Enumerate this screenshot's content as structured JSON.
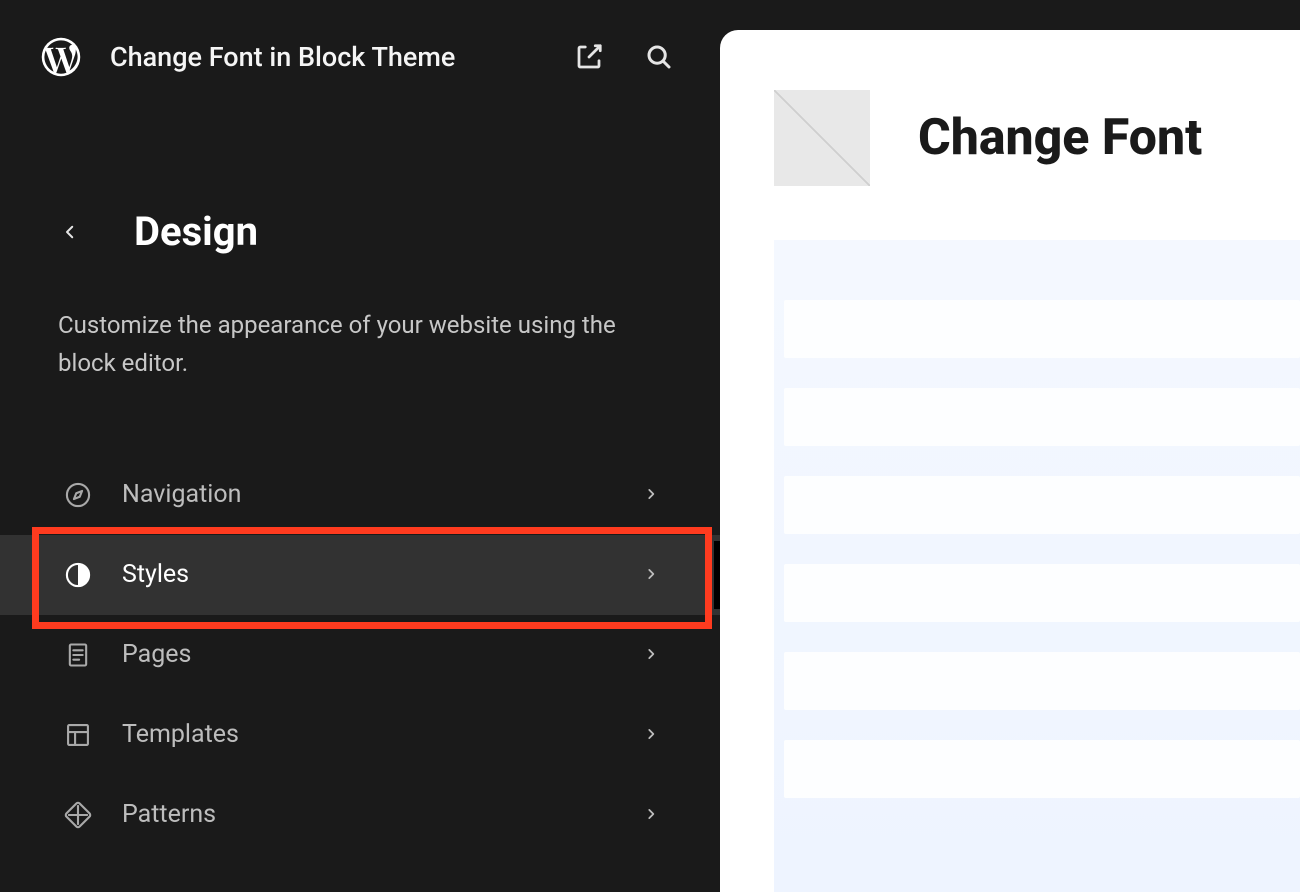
{
  "header": {
    "site_title": "Change Font in Block Theme"
  },
  "section": {
    "title": "Design",
    "description": "Customize the appearance of your website using the block editor."
  },
  "menu": {
    "items": [
      {
        "icon": "compass-icon",
        "label": "Navigation",
        "active": false
      },
      {
        "icon": "half-circle-icon",
        "label": "Styles",
        "active": true
      },
      {
        "icon": "page-icon",
        "label": "Pages",
        "active": false
      },
      {
        "icon": "layout-icon",
        "label": "Templates",
        "active": false
      },
      {
        "icon": "diamond-icon",
        "label": "Patterns",
        "active": false
      }
    ]
  },
  "preview": {
    "title": "Change Font"
  },
  "colors": {
    "highlight": "#ff3b1f",
    "sidebar_bg": "#1a1a1a",
    "active_bg": "#323232"
  }
}
